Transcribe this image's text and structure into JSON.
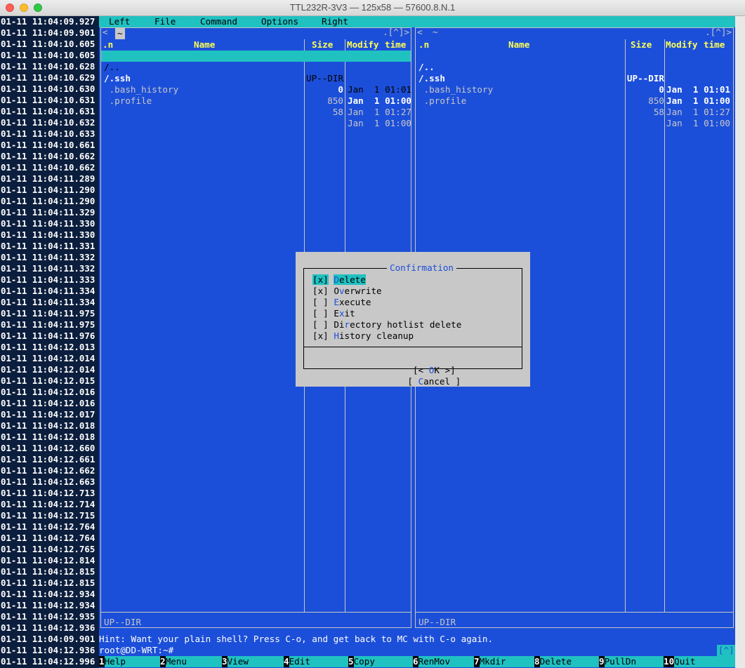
{
  "window": {
    "title": "TTL232R-3V3 — 125x58 — 57600.8.N.1"
  },
  "timestamps": [
    "01-11 11:04:09.927",
    "01-11 11:04:09.901",
    "01-11 11:04:10.605",
    "01-11 11:04:10.605",
    "01-11 11:04:10.628",
    "01-11 11:04:10.629",
    "01-11 11:04:10.630",
    "01-11 11:04:10.631",
    "01-11 11:04:10.631",
    "01-11 11:04:10.632",
    "01-11 11:04:10.633",
    "01-11 11:04:10.661",
    "01-11 11:04:10.662",
    "01-11 11:04:10.662",
    "01-11 11:04:11.289",
    "01-11 11:04:11.290",
    "01-11 11:04:11.290",
    "01-11 11:04:11.329",
    "01-11 11:04:11.330",
    "01-11 11:04:11.330",
    "01-11 11:04:11.331",
    "01-11 11:04:11.332",
    "01-11 11:04:11.332",
    "01-11 11:04:11.333",
    "01-11 11:04:11.334",
    "01-11 11:04:11.334",
    "01-11 11:04:11.975",
    "01-11 11:04:11.975",
    "01-11 11:04:11.976",
    "01-11 11:04:12.013",
    "01-11 11:04:12.014",
    "01-11 11:04:12.014",
    "01-11 11:04:12.015",
    "01-11 11:04:12.016",
    "01-11 11:04:12.016",
    "01-11 11:04:12.017",
    "01-11 11:04:12.018",
    "01-11 11:04:12.018",
    "01-11 11:04:12.660",
    "01-11 11:04:12.661",
    "01-11 11:04:12.662",
    "01-11 11:04:12.663",
    "01-11 11:04:12.713",
    "01-11 11:04:12.714",
    "01-11 11:04:12.715",
    "01-11 11:04:12.764",
    "01-11 11:04:12.764",
    "01-11 11:04:12.765",
    "01-11 11:04:12.814",
    "01-11 11:04:12.815",
    "01-11 11:04:12.815",
    "01-11 11:04:12.934",
    "01-11 11:04:12.934",
    "01-11 11:04:12.935",
    "01-11 11:04:12.936",
    "01-11 11:04:09.901",
    "01-11 11:04:12.936",
    "01-11 11:04:12.996"
  ],
  "menubar": {
    "left": "Left",
    "file": "File",
    "command": "Command",
    "options": "Options",
    "right": "Right"
  },
  "left_panel": {
    "path": "~",
    "corner": ".[^]>",
    "corner_left": "<",
    "columns": {
      "n": ".n",
      "name": "Name",
      "size": "Size",
      "modify": "Modify",
      "time": "time"
    },
    "rows": [
      {
        "name": "/..",
        "size": "UP--DIR",
        "date": "Jan  1 01:01"
      },
      {
        "name": "/.ssh",
        "size": "0",
        "date": "Jan  1 01:00"
      },
      {
        "name": " .bash_history",
        "size": "850",
        "date": "Jan  1 01:27"
      },
      {
        "name": " .profile",
        "size": "58",
        "date": "Jan  1 01:00"
      }
    ],
    "status": "UP--DIR"
  },
  "right_panel": {
    "path": "~",
    "corner": ".[^]>",
    "corner_left": "<",
    "columns": {
      "n": ".n",
      "name": "Name",
      "size": "Size",
      "modify": "Modify",
      "time": "time"
    },
    "rows": [
      {
        "name": "/..",
        "size": "UP--DIR",
        "date": "Jan  1 01:01"
      },
      {
        "name": "/.ssh",
        "size": "0",
        "date": "Jan  1 01:00"
      },
      {
        "name": " .bash_history",
        "size": "850",
        "date": "Jan  1 01:27"
      },
      {
        "name": " .profile",
        "size": "58",
        "date": "Jan  1 01:00"
      }
    ],
    "status": "UP--DIR"
  },
  "dialog": {
    "title": "Confirmation",
    "options": [
      {
        "box": "[x]",
        "hot": "D",
        "rest": "elete"
      },
      {
        "box": "[x]",
        "pre": "O",
        "hot": "v",
        "rest": "erwrite"
      },
      {
        "box": "[ ]",
        "hot": "E",
        "rest": "xecute"
      },
      {
        "box": "[ ]",
        "pre": "E",
        "hot": "x",
        "rest": "it"
      },
      {
        "box": "[ ]",
        "pre": "Di",
        "hot": "r",
        "rest": "ectory hotlist delete"
      },
      {
        "box": "[x]",
        "hot": "H",
        "rest": "istory cleanup"
      }
    ],
    "ok_pre": "[< ",
    "ok_hot": "O",
    "ok_rest": "K >]",
    "cancel_pre": "[ ",
    "cancel_hot": "C",
    "cancel_rest": "ancel ]"
  },
  "hint": "Hint: Want your plain shell? Press C-o, and get back to MC with C-o again.",
  "prompt": "root@DD-WRT:~#",
  "caret": "[^]",
  "fkeys": [
    {
      "n": "1",
      "label": "Help"
    },
    {
      "n": "2",
      "label": "Menu"
    },
    {
      "n": "3",
      "label": "View"
    },
    {
      "n": "4",
      "label": "Edit"
    },
    {
      "n": "5",
      "label": "Copy"
    },
    {
      "n": "6",
      "label": "RenMov"
    },
    {
      "n": "7",
      "label": "Mkdir"
    },
    {
      "n": "8",
      "label": "Delete"
    },
    {
      "n": "9",
      "label": "PullDn"
    },
    {
      "n": "10",
      "label": "Quit"
    }
  ]
}
